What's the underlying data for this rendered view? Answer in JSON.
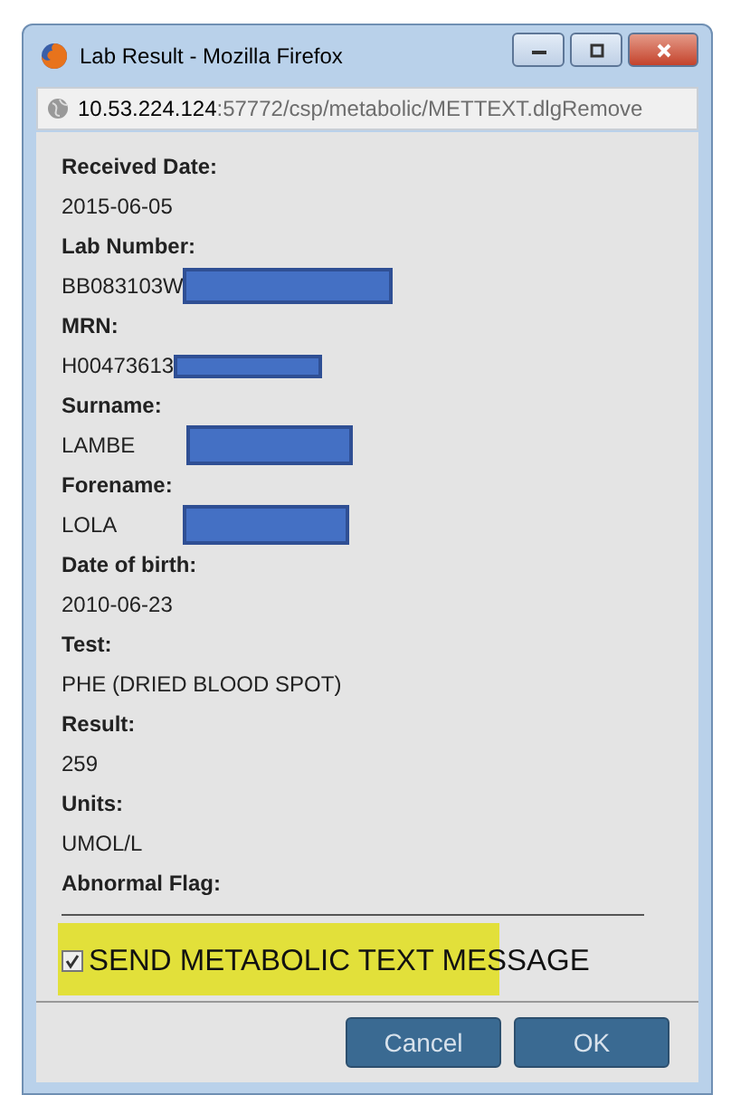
{
  "window": {
    "title": "Lab Result - Mozilla Firefox"
  },
  "address_bar": {
    "host": "10.53.224.124",
    "path": ":57772/csp/metabolic/METTEXT.dlgRemove"
  },
  "fields": [
    {
      "label": "Received Date:",
      "value": "2015-06-05"
    },
    {
      "label": "Lab Number:",
      "value": "BB083103W",
      "redacted": true
    },
    {
      "label": "MRN:",
      "value": "H00473613",
      "redacted": true
    },
    {
      "label": "Surname:",
      "value": "LAMBE",
      "redacted": true
    },
    {
      "label": "Forename:",
      "value": "LOLA",
      "redacted": true
    },
    {
      "label": "Date of birth:",
      "value": "2010-06-23"
    },
    {
      "label": "Test:",
      "value": "PHE (DRIED BLOOD SPOT)"
    },
    {
      "label": "Result:",
      "value": "259"
    },
    {
      "label": "Units:",
      "value": "UMOL/L"
    },
    {
      "label": "Abnormal Flag:"
    }
  ],
  "send_message": {
    "label": "SEND METABOLIC TEXT MESSAGE",
    "checked": true,
    "highlighted": true
  },
  "buttons": [
    {
      "label": "Cancel"
    },
    {
      "label": "OK"
    }
  ]
}
